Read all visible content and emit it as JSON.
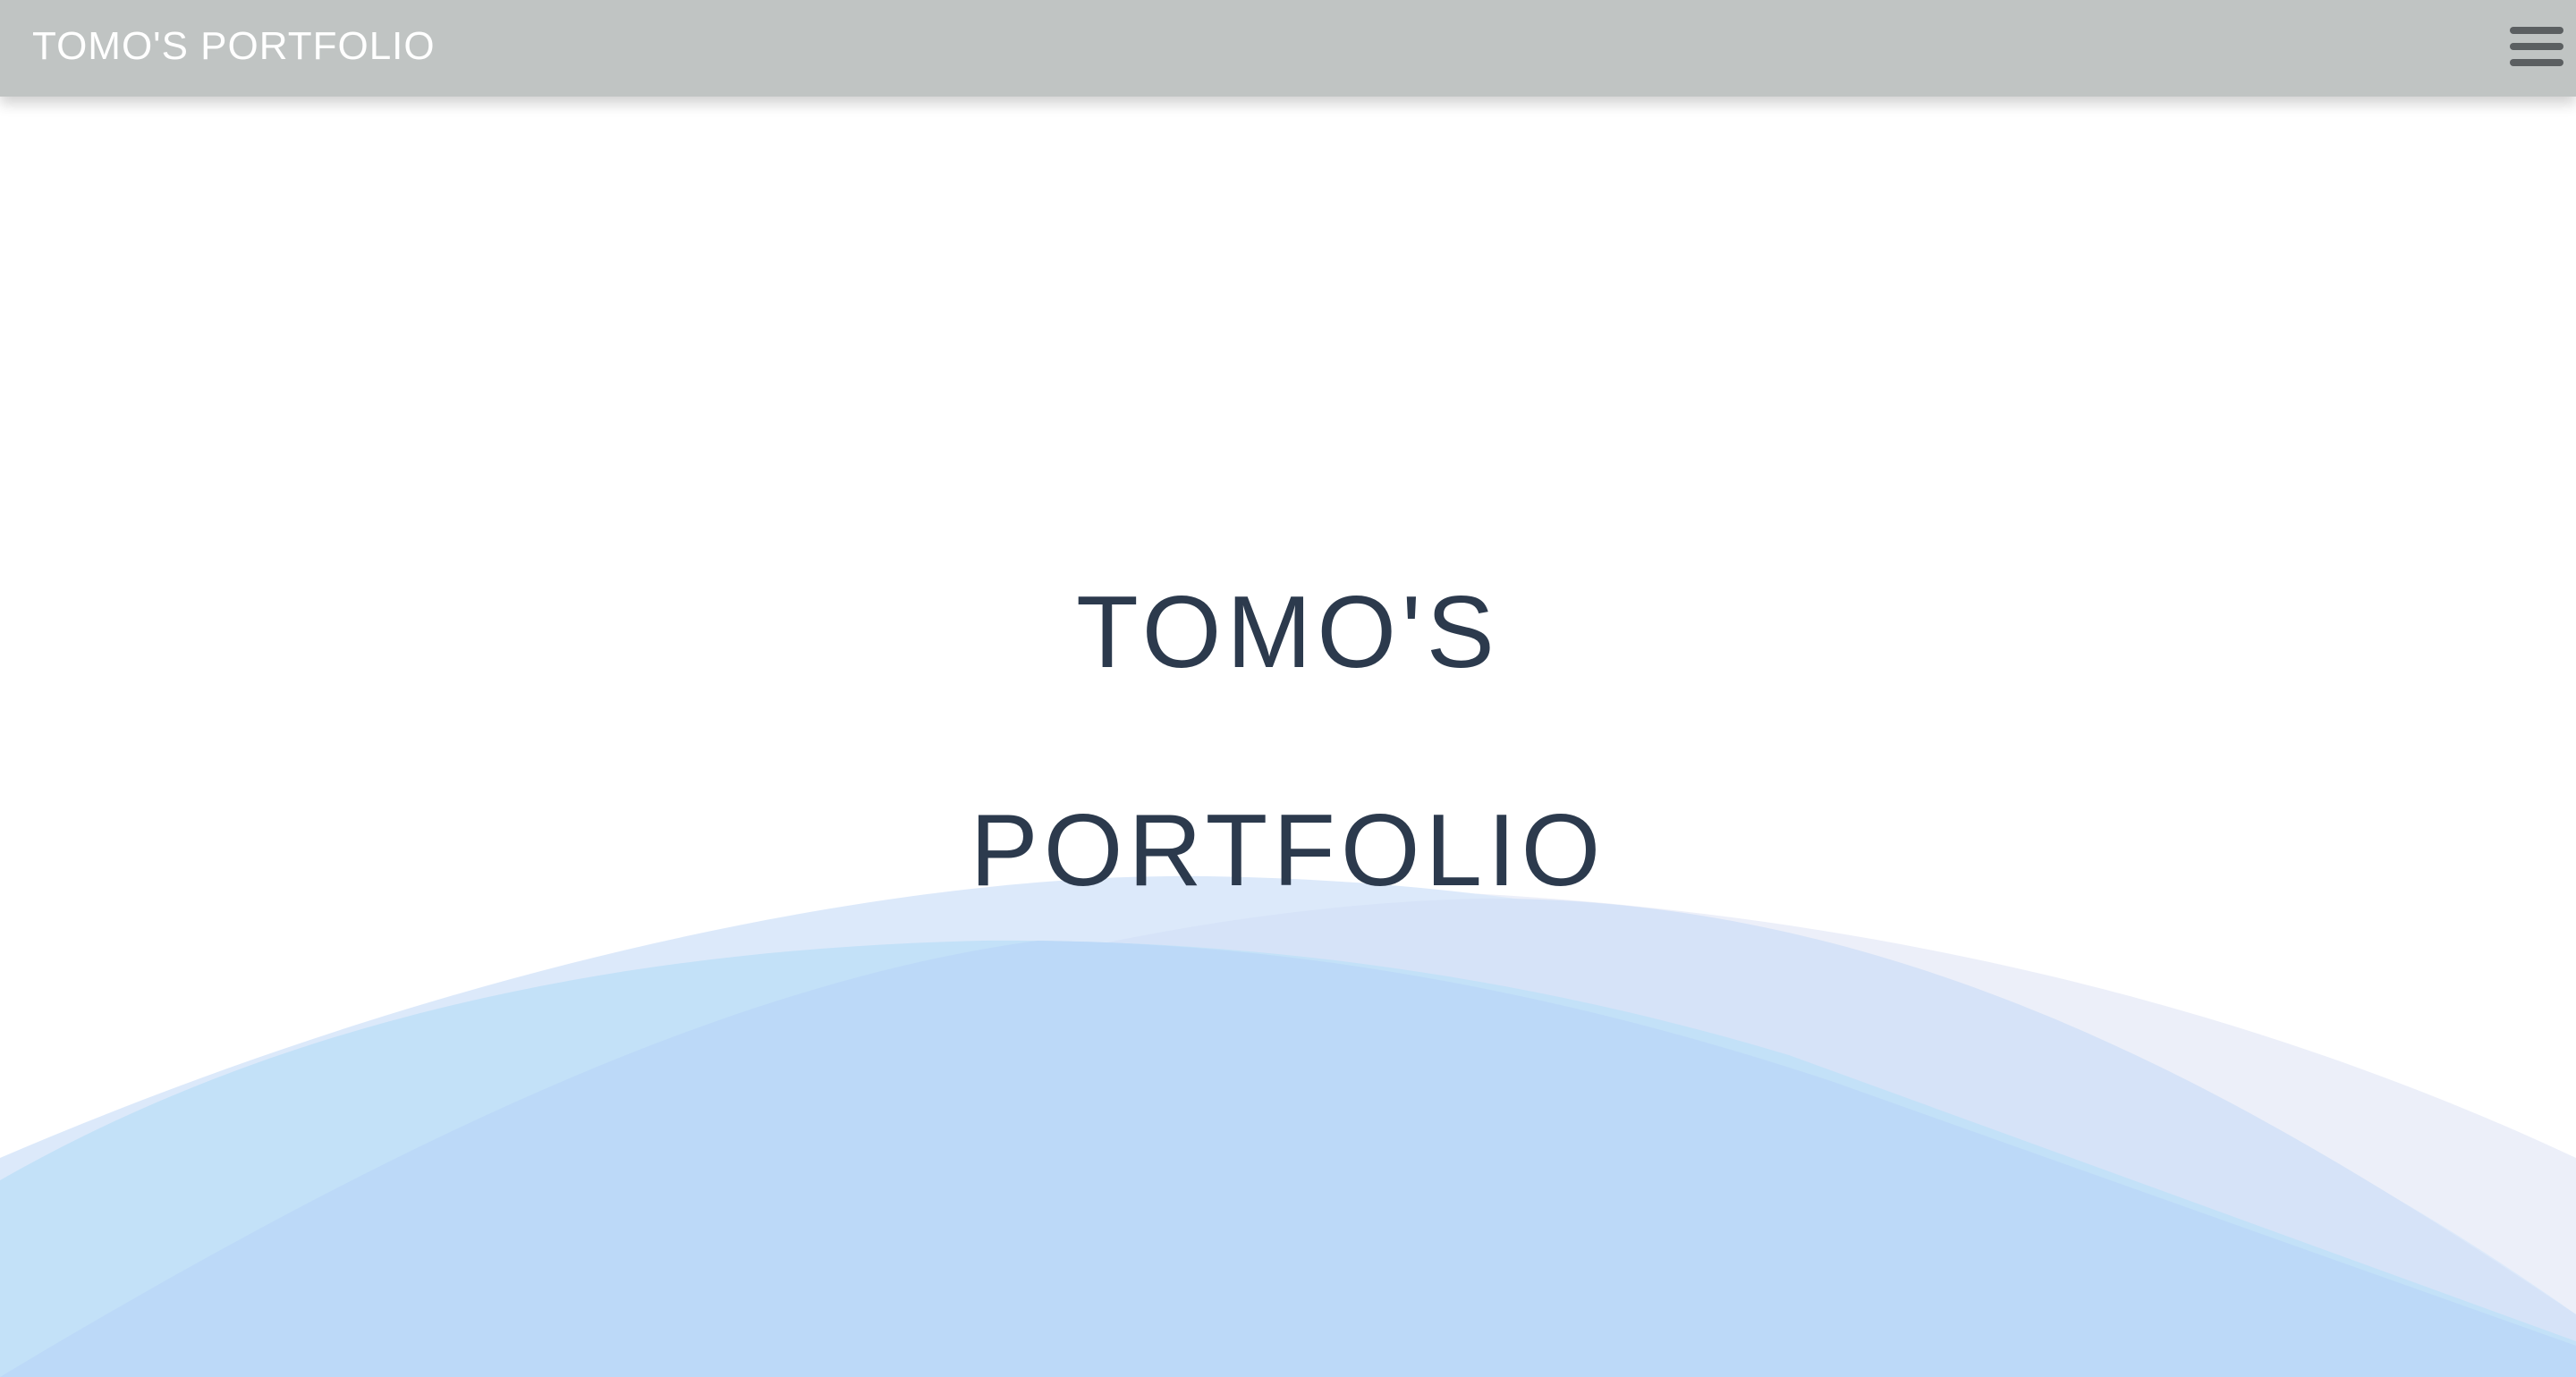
{
  "header": {
    "brand": "TOMO'S PORTFOLIO",
    "menu_icon": "hamburger-menu-icon"
  },
  "hero": {
    "line1": "TOMO'S",
    "line2": "PORTFOLIO"
  },
  "colors": {
    "header_background": "#c0c4c3",
    "header_text": "#ffffff",
    "menu_icon": "#5b5f61",
    "hero_text": "#2c3a4d",
    "wave_light_lavender": "#eceff9",
    "wave_light_blue": "#dce9fa",
    "wave_sky_blue": "#c3e1f8",
    "wave_periwinkle": "#d6e3f8",
    "wave_main_blue": "#bcd9f8"
  }
}
